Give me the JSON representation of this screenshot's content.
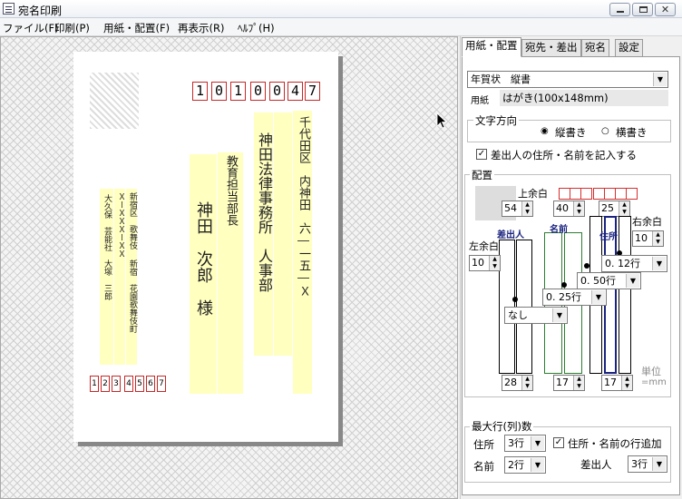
{
  "window": {
    "title": "宛名印刷"
  },
  "menu": [
    "ファイル(F)",
    "印刷(P)",
    "用紙・配置(F)",
    "再表示(R)",
    "ﾍﾙﾌﾟ(H)"
  ],
  "card": {
    "zip": [
      "1",
      "0",
      "1",
      "0",
      "0",
      "4",
      "7"
    ],
    "address1": "千代田区　内神田　六―一五―Ｘ",
    "company": "神田法律事務所　人事部",
    "title": "教育担当部長",
    "recipient": "神田　次郎　様",
    "sender_addr1": "新宿区　歌舞伎",
    "sender_addr2": "ＸーＸＸＸーＸＸ",
    "sender_addr3": "新宿　花園歌舞伎町",
    "sender_name": "大久保　芸能社　大塚　三郎",
    "sender_zip": [
      "1",
      "2",
      "3",
      "4",
      "5",
      "6",
      "7"
    ]
  },
  "tabs": [
    "用紙・配置",
    "宛先・差出",
    "宛名",
    "設定"
  ],
  "paper": {
    "type": "年賀状　縦書",
    "label": "用紙",
    "size": "はがき(100x148mm)"
  },
  "direction": {
    "label": "文字方向",
    "vertical": "縦書き",
    "horizontal": "横書き"
  },
  "sender_check": "差出人の住所・名前を記入する",
  "layout": {
    "label": "配置",
    "top_margin": "上余白",
    "left_margin": "左余白",
    "right_margin": "右余白",
    "spin_54": "54",
    "spin_40": "40",
    "spin_25": "25",
    "spin_left": "10",
    "spin_right": "10",
    "col_sender": "差出人",
    "col_name": "名前",
    "col_address": "住所",
    "sel_012": "0. 12行",
    "sel_050": "0. 50行",
    "sel_025": "0. 25行",
    "sel_none": "なし",
    "spin_28": "28",
    "spin_17a": "17",
    "spin_17b": "17",
    "unit": "単位",
    "unit_mm": "=mm"
  },
  "maxlines": {
    "label": "最大行(列)数",
    "address": "住所",
    "address_val": "3行",
    "add_check": "住所・名前の行追加",
    "name": "名前",
    "name_val": "2行",
    "sender": "差出人",
    "sender_val": "3行"
  }
}
